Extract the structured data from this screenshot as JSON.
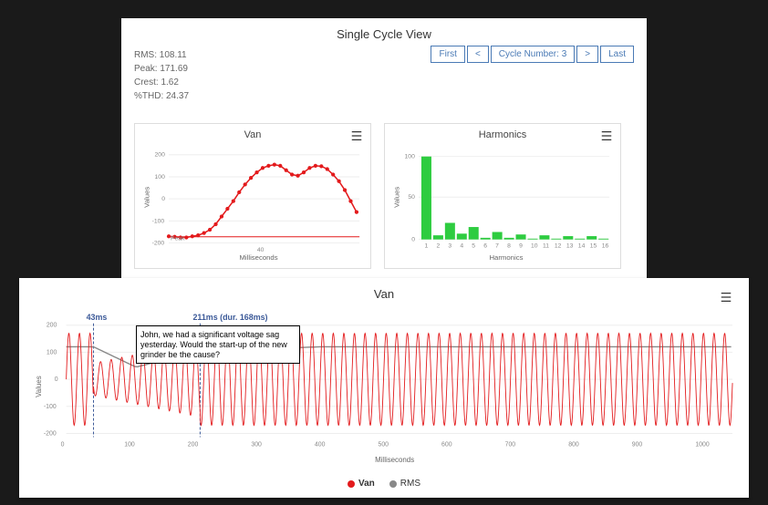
{
  "top_panel": {
    "title": "Single Cycle View",
    "stats": {
      "rms_label": "RMS: 108.11",
      "peak_label": "Peak: 171.69",
      "crest_label": "Crest: 1.62",
      "thd_label": "%THD: 24.37"
    },
    "nav": {
      "first": "First",
      "prev": "<",
      "cycle": "Cycle Number: 3",
      "next": ">",
      "last": "Last"
    }
  },
  "van_chart": {
    "title": "Van",
    "ylabel": "Values",
    "xlabel": "Milliseconds",
    "peak_annotation": "Peak"
  },
  "harmonics_chart": {
    "title": "Harmonics",
    "ylabel": "Values",
    "xlabel": "Harmonics"
  },
  "bottom_chart": {
    "title": "Van",
    "ylabel": "Values",
    "xlabel": "Milliseconds",
    "marker1": "43ms",
    "marker2": "211ms (dur. 168ms)",
    "annotation": "John, we had a significant voltage sag yesterday. Would the start-up of the new grinder be the cause?",
    "legend": {
      "van": "Van",
      "rms": "RMS"
    }
  },
  "chart_data": [
    {
      "type": "line",
      "title": "Van",
      "xlabel": "Milliseconds",
      "ylabel": "Values",
      "ylim": [
        -200,
        200
      ],
      "xlim": [
        0,
        65
      ],
      "x": [
        0,
        2,
        4,
        6,
        8,
        10,
        12,
        14,
        16,
        18,
        20,
        22,
        24,
        26,
        28,
        30,
        32,
        34,
        36,
        38,
        40,
        42,
        44,
        46,
        48,
        50,
        52,
        54,
        56,
        58,
        60,
        62,
        64
      ],
      "values": [
        -170,
        -172,
        -175,
        -175,
        -170,
        -165,
        -155,
        -140,
        -115,
        -80,
        -45,
        -10,
        30,
        65,
        95,
        120,
        140,
        150,
        155,
        150,
        130,
        110,
        105,
        120,
        140,
        150,
        148,
        135,
        110,
        80,
        40,
        -10,
        -60
      ],
      "reference_line": -172,
      "annotations": [
        {
          "label": "Peak",
          "x": 6,
          "y": -172
        }
      ]
    },
    {
      "type": "bar",
      "title": "Harmonics",
      "xlabel": "Harmonics",
      "ylabel": "Values",
      "ylim": [
        0,
        100
      ],
      "categories": [
        1,
        2,
        3,
        4,
        5,
        6,
        7,
        8,
        9,
        10,
        11,
        12,
        13,
        14,
        15,
        16
      ],
      "values": [
        100,
        5,
        20,
        7,
        15,
        2,
        9,
        2,
        6,
        1,
        5,
        1,
        4,
        1,
        4,
        1
      ]
    },
    {
      "type": "line",
      "title": "Van",
      "xlabel": "Milliseconds",
      "ylabel": "Values",
      "ylim": [
        -200,
        200
      ],
      "xlim": [
        0,
        1050
      ],
      "series": [
        {
          "name": "Van",
          "color": "#e31a1c",
          "note": "sinusoidal ~60Hz; amplitude ~170 nominal, dips to ~60 during 43–211ms sag, recovers to ~170"
        },
        {
          "name": "RMS",
          "color": "#888",
          "note": "steady ~120, drops to ~45 during sag window (43–211ms), recovers toward ~120"
        }
      ],
      "markers": [
        {
          "x": 43,
          "label": "43ms"
        },
        {
          "x": 211,
          "label": "211ms (dur. 168ms)"
        }
      ],
      "annotation_text": "John, we had a significant voltage sag yesterday. Would the start-up of the new grinder be the cause?"
    }
  ]
}
